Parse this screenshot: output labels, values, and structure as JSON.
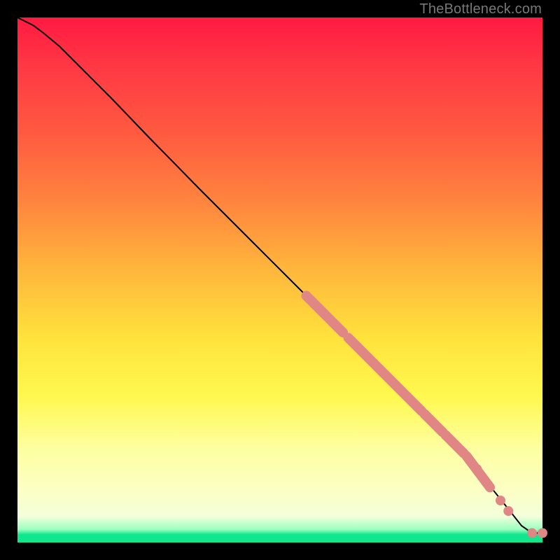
{
  "watermark": "TheBottleneck.com",
  "chart_data": {
    "type": "line",
    "title": "",
    "xlabel": "",
    "ylabel": "",
    "xlim": [
      0,
      100
    ],
    "ylim": [
      0,
      100
    ],
    "grid": false,
    "legend": false,
    "series": [
      {
        "name": "curve",
        "x": [
          0,
          3,
          5,
          8,
          12,
          18,
          25,
          35,
          45,
          55,
          65,
          75,
          85,
          93,
          96,
          98,
          100
        ],
        "y": [
          100,
          98.5,
          97,
          94.5,
          90.5,
          84.5,
          77.2,
          67,
          57,
          47,
          37,
          27,
          17,
          7,
          3.2,
          1.8,
          1.8
        ]
      }
    ],
    "highlight_segments": [
      {
        "x0": 55,
        "y0": 47,
        "x1": 62,
        "y1": 40
      },
      {
        "x0": 63,
        "y0": 39,
        "x1": 77,
        "y1": 25
      },
      {
        "x0": 77.5,
        "y0": 24.5,
        "x1": 81,
        "y1": 21
      },
      {
        "x0": 81.5,
        "y0": 20.5,
        "x1": 85,
        "y1": 17
      },
      {
        "x0": 85.5,
        "y0": 16.5,
        "x1": 90,
        "y1": 10.5
      }
    ],
    "highlight_points": [
      {
        "x": 87.5,
        "y": 14
      },
      {
        "x": 92,
        "y": 8
      },
      {
        "x": 93.5,
        "y": 6
      },
      {
        "x": 98,
        "y": 1.8
      },
      {
        "x": 100,
        "y": 1.8
      }
    ]
  }
}
